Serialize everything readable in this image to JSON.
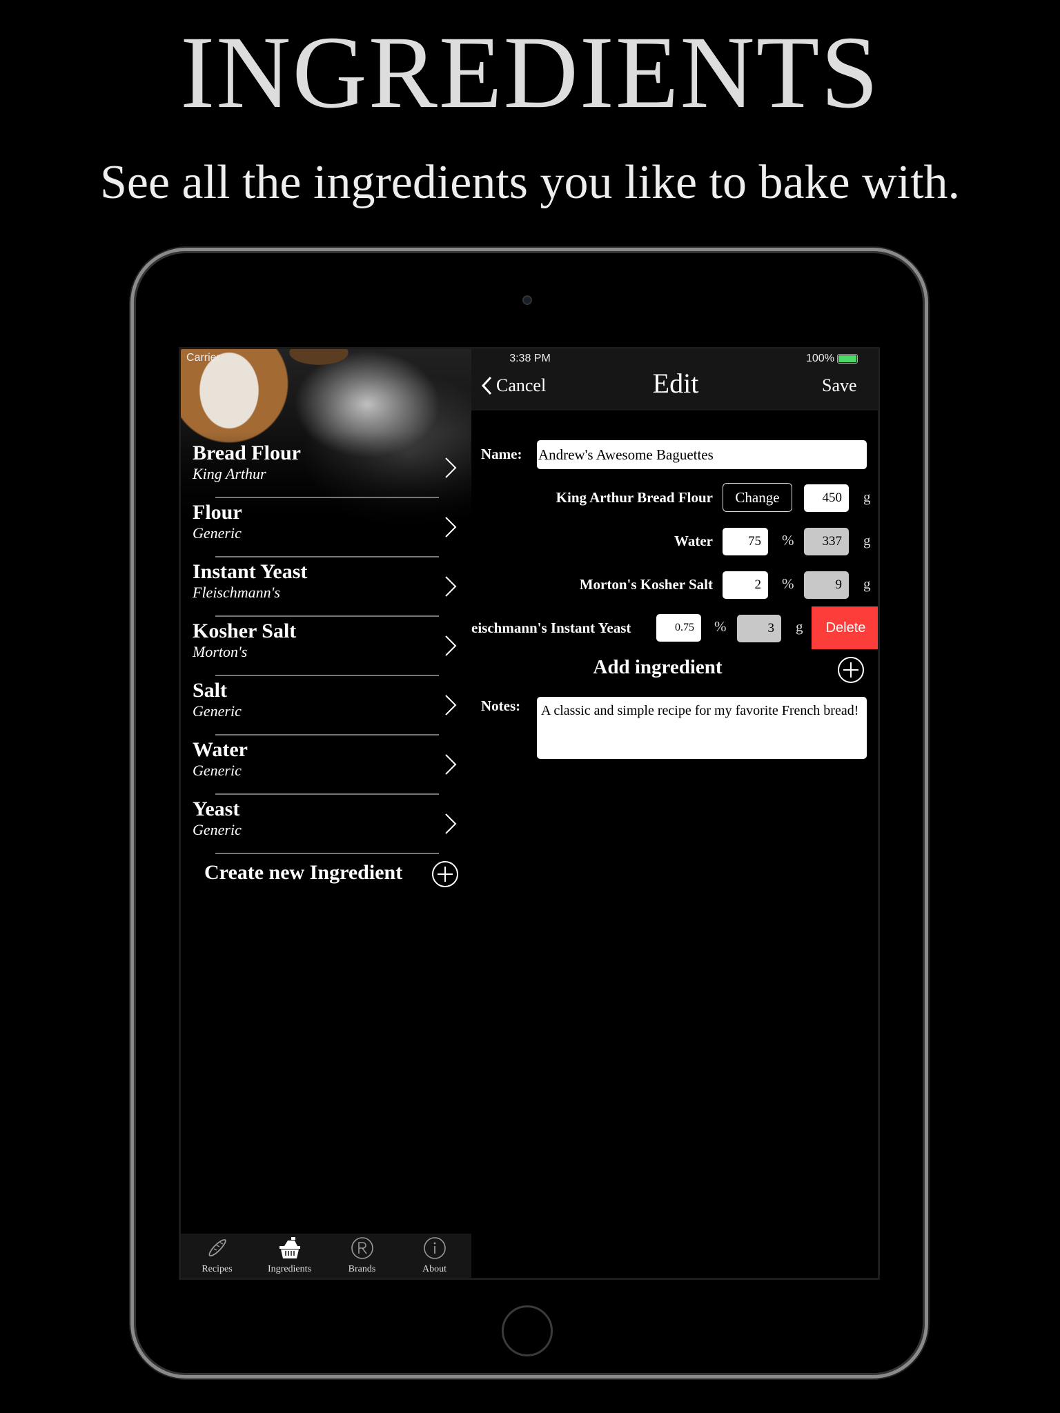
{
  "promo": {
    "title": "INGREDIENTS",
    "subtitle": "See all the ingredients you like to bake with."
  },
  "status": {
    "carrier": "Carrier",
    "time": "3:38 PM",
    "battery": "100%"
  },
  "ingredients": [
    {
      "name": "Bread Flour",
      "brand": "King Arthur"
    },
    {
      "name": "Flour",
      "brand": "Generic"
    },
    {
      "name": "Instant Yeast",
      "brand": "Fleischmann's"
    },
    {
      "name": "Kosher Salt",
      "brand": "Morton's"
    },
    {
      "name": "Salt",
      "brand": "Generic"
    },
    {
      "name": "Water",
      "brand": "Generic"
    },
    {
      "name": "Yeast",
      "brand": "Generic"
    }
  ],
  "create_label": "Create new Ingredient",
  "tabs": [
    {
      "label": "Recipes",
      "icon": "bread-icon"
    },
    {
      "label": "Ingredients",
      "icon": "basket-icon",
      "selected": true
    },
    {
      "label": "Brands",
      "icon": "registered-icon"
    },
    {
      "label": "About",
      "icon": "info-icon"
    }
  ],
  "nav": {
    "cancel": "Cancel",
    "title": "Edit",
    "save": "Save"
  },
  "form": {
    "name_label": "Name:",
    "name_value": "Andrew's Awesome Baguettes",
    "base": {
      "label": "King Arthur Bread Flour",
      "change": "Change",
      "grams": "450",
      "unit": "g"
    },
    "rows": [
      {
        "label": "Water",
        "percent": "75",
        "grams": "337",
        "pct_unit": "%",
        "unit": "g"
      },
      {
        "label": "Morton's Kosher Salt",
        "percent": "2",
        "grams": "9",
        "pct_unit": "%",
        "unit": "g"
      },
      {
        "label": "eischmann's Instant Yeast",
        "percent": "0.75",
        "grams": "3",
        "pct_unit": "%",
        "unit": "g"
      }
    ],
    "delete": "Delete",
    "add_ingredient": "Add ingredient",
    "notes_label": "Notes:",
    "notes_value": "A classic and simple recipe for my favorite French bread!"
  },
  "colors": {
    "delete": "#fc3d39",
    "battery": "#4cd964",
    "navbar": "#161616"
  }
}
